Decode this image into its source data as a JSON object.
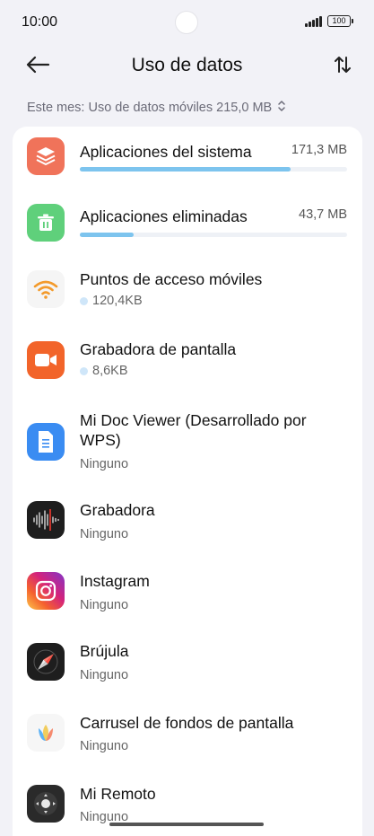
{
  "status": {
    "time": "10:00",
    "battery": "100"
  },
  "header": {
    "title": "Uso de datos"
  },
  "summary": {
    "text": "Este mes: Uso de datos móviles 215,0 MB"
  },
  "apps": [
    {
      "name": "Aplicaciones del sistema",
      "size": "171,3 MB",
      "usage_fraction": 0.79,
      "icon": "layers-icon",
      "color": "#f0735a"
    },
    {
      "name": "Aplicaciones eliminadas",
      "size": "43,7 MB",
      "usage_fraction": 0.2,
      "icon": "trash-icon",
      "color": "#5fd07b"
    },
    {
      "name": "Puntos de acceso móviles",
      "detail": "120,4KB",
      "icon": "wifi-icon"
    },
    {
      "name": "Grabadora de pantalla",
      "detail": "8,6KB",
      "icon": "video-camera-icon"
    },
    {
      "name": "Mi Doc Viewer (Desarrollado por WPS)",
      "detail": "Ninguno",
      "icon": "document-icon"
    },
    {
      "name": "Grabadora",
      "detail": "Ninguno",
      "icon": "sound-wave-icon"
    },
    {
      "name": "Instagram",
      "detail": "Ninguno",
      "icon": "instagram-icon"
    },
    {
      "name": "Brújula",
      "detail": "Ninguno",
      "icon": "compass-icon"
    },
    {
      "name": "Carrusel de fondos de pantalla",
      "detail": "Ninguno",
      "icon": "flower-icon"
    },
    {
      "name": "Mi Remoto",
      "detail": "Ninguno",
      "icon": "remote-icon"
    }
  ],
  "colors": {
    "accent_bar": "#7dc4ee",
    "background": "#f2f2f7"
  }
}
